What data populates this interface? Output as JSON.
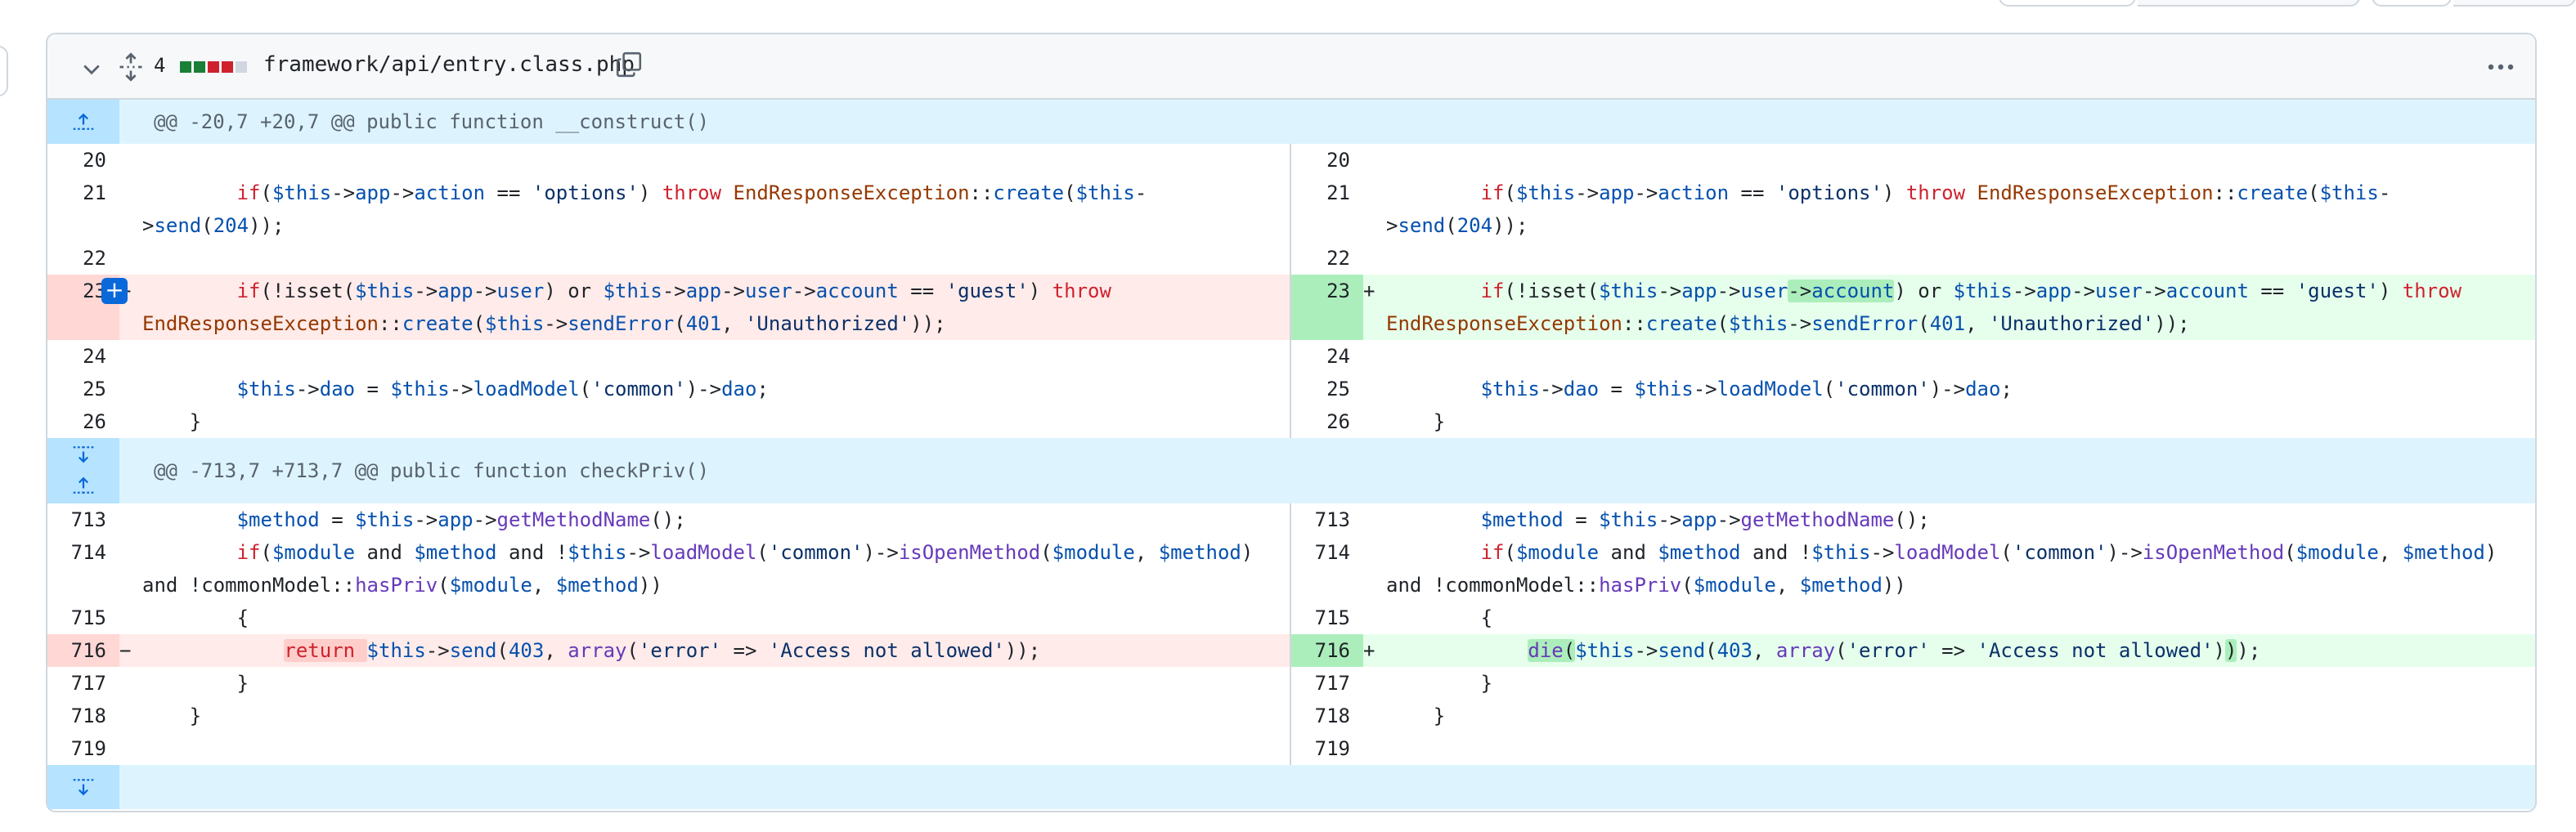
{
  "file": {
    "changes_count": "4",
    "path": "framework/api/entry.class.php",
    "diffstat": [
      "#1a7f37",
      "#1a7f37",
      "#cf222e",
      "#cf222e",
      "#d0d7de"
    ]
  },
  "hunks": [
    {
      "header": "@@ -20,7 +20,7 @@ public function __construct()"
    },
    {
      "header": "@@ -713,7 +713,7 @@ public function checkPriv()"
    }
  ],
  "colors": {
    "deletion_bg": "#ffebe9",
    "addition_bg": "#e6ffec",
    "hunk_bg": "#ddf4ff",
    "accent": "#0969da"
  }
}
